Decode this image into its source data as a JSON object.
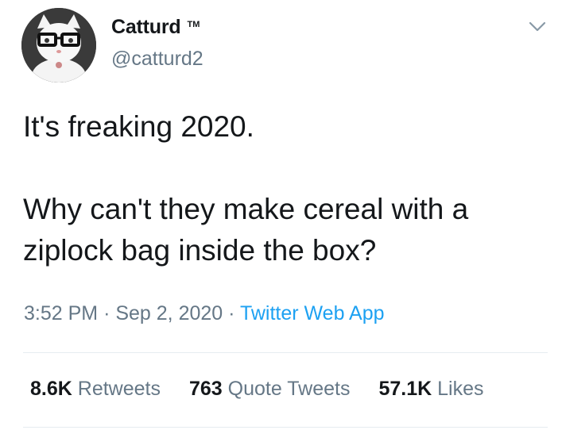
{
  "user": {
    "display_name": "Catturd",
    "trademark": "TM",
    "handle": "@catturd2"
  },
  "tweet": {
    "line1": "It's freaking 2020.",
    "line2": "Why can't they make cereal with a",
    "line3": "ziplock bag inside the box?"
  },
  "meta": {
    "time": "3:52 PM",
    "separator": "·",
    "date": "Sep 2, 2020",
    "app": "Twitter Web App"
  },
  "stats": [
    {
      "count": "8.6K",
      "label": "Retweets"
    },
    {
      "count": "763",
      "label": "Quote Tweets"
    },
    {
      "count": "57.1K",
      "label": "Likes"
    }
  ],
  "icons": {
    "avatar": "cat-with-glasses-avatar",
    "menu": "chevron-down-icon"
  },
  "colors": {
    "text": "#14171a",
    "secondary": "#657786",
    "link": "#1da1f2",
    "divider": "#e6ecf0"
  }
}
